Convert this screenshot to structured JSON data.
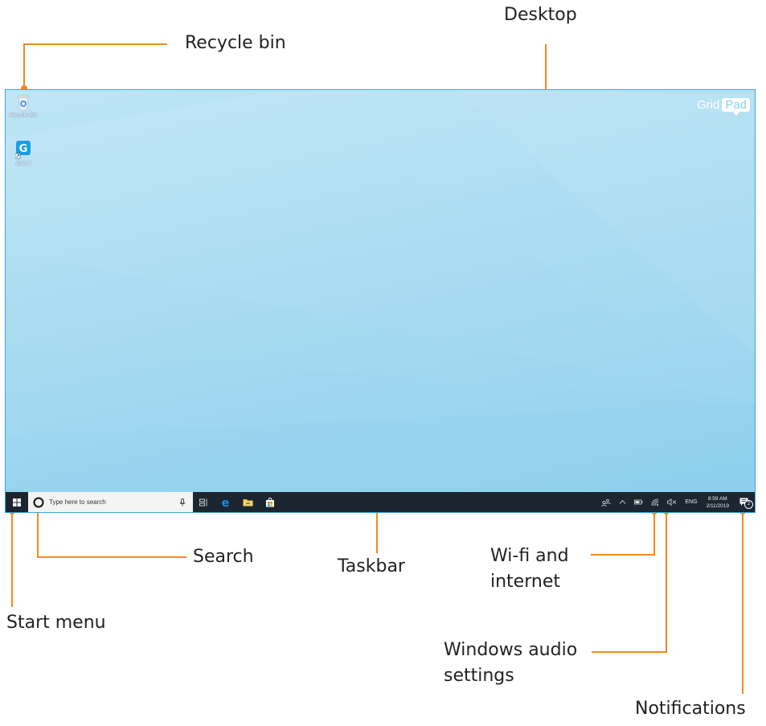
{
  "callouts": {
    "recycle_bin": "Recycle bin",
    "desktop": "Desktop",
    "search": "Search",
    "taskbar": "Taskbar",
    "wifi": "Wi-fi and\ninternet",
    "start_menu": "Start menu",
    "audio": "Windows audio\nsettings",
    "notifications": "Notifications"
  },
  "desktop": {
    "icons": [
      {
        "label": "Recycle Bin",
        "icon": "recycle-bin-icon"
      },
      {
        "label": "Grid 3",
        "icon": "grid3-app-icon"
      }
    ],
    "brand": {
      "part1": "Grid",
      "part2": "Pad"
    }
  },
  "taskbar": {
    "search_placeholder": "Type here to search",
    "language": "ENG",
    "time": "8:59 AM",
    "date": "2/11/2019",
    "notification_count": "2"
  },
  "colors": {
    "callout_line": "#f28a1e",
    "taskbar": "#1c2630",
    "desktop": "#a9dcf2"
  }
}
